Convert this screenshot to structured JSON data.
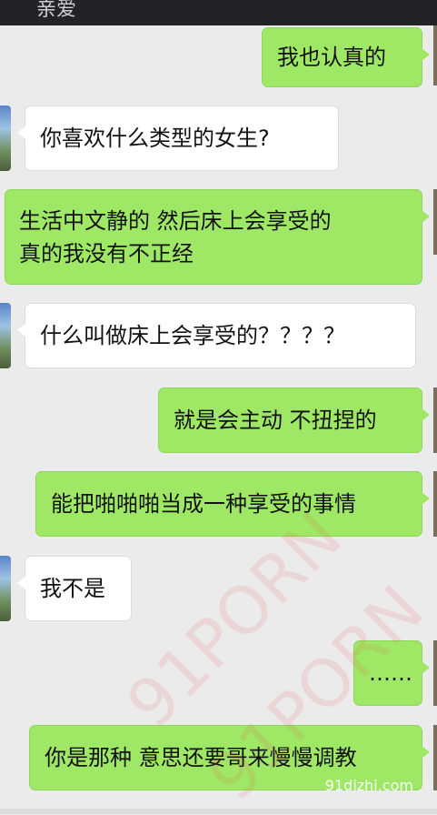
{
  "header": {
    "title": "亲爱"
  },
  "messages": [
    {
      "side": "sent",
      "text": "我也认真的"
    },
    {
      "side": "recv",
      "text": "你喜欢什么类型的女生?"
    },
    {
      "side": "sent",
      "line1": "生活中文静的 然后床上会享受的",
      "line2": "真的我没有不正经"
    },
    {
      "side": "recv",
      "text": "什么叫做床上会享受的？？？？"
    },
    {
      "side": "sent",
      "text": "就是会主动 不扭捏的"
    },
    {
      "side": "sent",
      "text": "能把啪啪啪当成一种享受的事情"
    },
    {
      "side": "recv",
      "text": "我不是"
    },
    {
      "side": "sent",
      "text": "……"
    },
    {
      "side": "sent",
      "text": "你是那种 意思还要哥来慢慢调教"
    }
  ],
  "watermarks": [
    "91PORN",
    "91PORN"
  ],
  "site": "91dizhi.com",
  "colors": {
    "sent_bubble": "#9fe866",
    "recv_bubble": "#ffffff",
    "background": "#ebebeb"
  }
}
